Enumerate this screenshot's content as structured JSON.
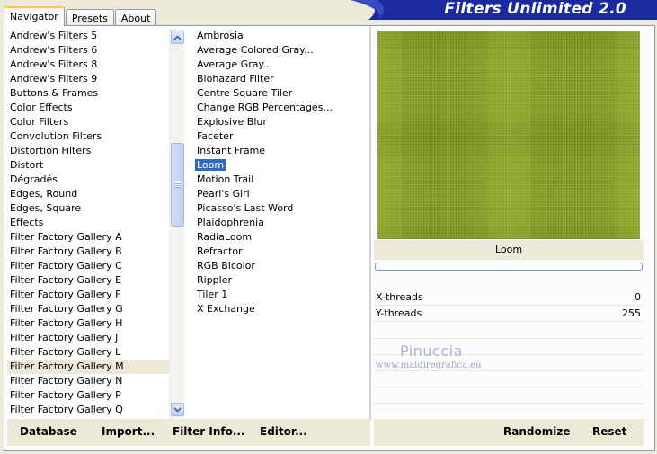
{
  "banner": {
    "title": "Filters Unlimited 2.0"
  },
  "tabs": [
    {
      "label": "Navigator",
      "active": true
    },
    {
      "label": "Presets",
      "active": false
    },
    {
      "label": "About",
      "active": false
    }
  ],
  "categories": [
    "Andrew's Filters 5",
    "Andrew's Filters 6",
    "Andrew's Filters 8",
    "Andrew's Filters 9",
    "Buttons & Frames",
    "Color Effects",
    "Color Filters",
    "Convolution Filters",
    "Distortion Filters",
    "Distort",
    "Dégradés",
    "Edges, Round",
    "Edges, Square",
    "Effects",
    "Filter Factory Gallery A",
    "Filter Factory Gallery B",
    "Filter Factory Gallery C",
    "Filter Factory Gallery E",
    "Filter Factory Gallery F",
    "Filter Factory Gallery G",
    "Filter Factory Gallery H",
    "Filter Factory Gallery J",
    "Filter Factory Gallery L",
    "Filter Factory Gallery M",
    "Filter Factory Gallery N",
    "Filter Factory Gallery P",
    "Filter Factory Gallery Q"
  ],
  "selected_category": "Filter Factory Gallery M",
  "filters": [
    "Ambrosia",
    "Average Colored Gray...",
    "Average Gray...",
    "Biohazard Filter",
    "Centre Square Tiler",
    "Change RGB Percentages...",
    "Explosive Blur",
    "Faceter",
    "Instant Frame",
    "Loom",
    "Motion Trail",
    "Pearl's Girl",
    "Picasso's Last Word",
    "Plaidophrenia",
    "RadiaLoom",
    "Refractor",
    "RGB Bicolor",
    "Rippler",
    "Tiler 1",
    "X Exchange"
  ],
  "selected_filter": "Loom",
  "preview": {
    "label": "Loom",
    "colors": {
      "base": "#8aa22c",
      "dark": "#4f6a12",
      "light": "#b2c85a"
    }
  },
  "params": [
    {
      "name": "X-threads",
      "value": "0"
    },
    {
      "name": "Y-threads",
      "value": "255"
    }
  ],
  "watermark": {
    "name": "Pinuccia",
    "url": "www.maidiregrafica.eu"
  },
  "buttons": {
    "database": "Database",
    "import": "Import...",
    "filter_info": "Filter Info...",
    "editor": "Editor...",
    "randomize": "Randomize",
    "reset": "Reset"
  },
  "icons": {
    "scroll_up": "chevron-up-icon",
    "scroll_down": "chevron-down-icon"
  }
}
